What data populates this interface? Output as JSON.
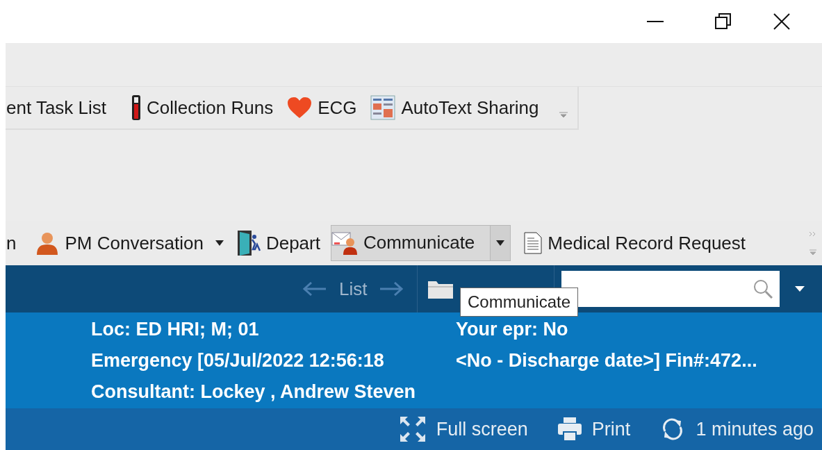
{
  "window": {
    "controls": [
      {
        "kind": "minimize"
      },
      {
        "kind": "maximize"
      },
      {
        "kind": "close"
      }
    ]
  },
  "toolbar_1": {
    "items": [
      {
        "kind": "text",
        "label": "ent Task List"
      },
      {
        "kind": "tube",
        "label": "Collection Runs"
      },
      {
        "kind": "heart",
        "label": "ECG"
      },
      {
        "kind": "autotext",
        "label": "AutoText Sharing"
      }
    ]
  },
  "toolbar_2": {
    "items": [
      {
        "kind": "text",
        "label": "n",
        "dropdown": false,
        "hovered": false
      },
      {
        "kind": "person",
        "label": "PM Conversation",
        "dropdown": true,
        "hovered": false
      },
      {
        "kind": "door",
        "label": "Depart",
        "dropdown": false,
        "hovered": false
      },
      {
        "kind": "communicate",
        "label": "Communicate",
        "dropdown": true,
        "hovered": true
      },
      {
        "kind": "document",
        "label": "Medical Record Request",
        "dropdown": false,
        "hovered": false
      }
    ]
  },
  "nav_bar": {
    "list_label": "List"
  },
  "tooltip": {
    "text": "Communicate"
  },
  "banner": {
    "rows": [
      [
        "Loc: ED HRI; M; 01",
        "Your epr: No"
      ],
      [
        "Emergency [05/Jul/2022 12:56:18",
        "<No - Discharge date>] Fin#:472..."
      ],
      [
        "Consultant: Lockey , Andrew Steven"
      ]
    ]
  },
  "footer": {
    "actions": [
      {
        "kind": "fullscreen",
        "label": "Full screen"
      },
      {
        "kind": "print",
        "label": "Print"
      },
      {
        "kind": "refresh",
        "label": "1 minutes ago"
      }
    ]
  }
}
